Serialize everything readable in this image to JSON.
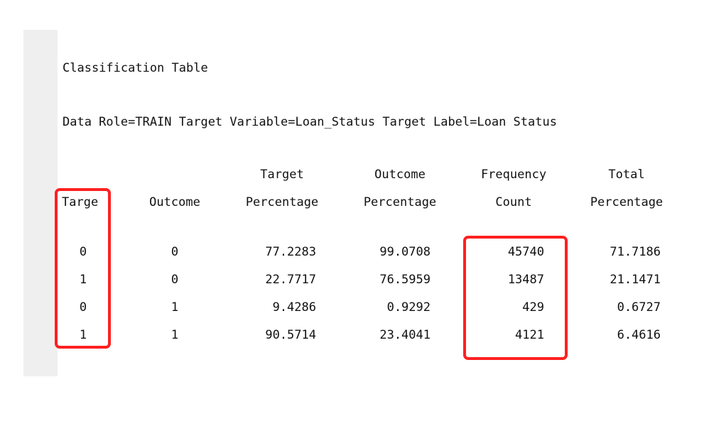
{
  "report": {
    "title": "Classification Table",
    "subtitle": "Data Role=TRAIN Target Variable=Loan_Status Target Label=Loan Status"
  },
  "table": {
    "headers": {
      "target": [
        "",
        "Targe"
      ],
      "outcome": [
        "",
        "Outcome"
      ],
      "target_pct": [
        "Target",
        "Percentage"
      ],
      "outcome_pct": [
        "Outcome",
        "Percentage"
      ],
      "freq": [
        "Frequency",
        "Count"
      ],
      "total_pct": [
        "Total",
        "Percentage"
      ]
    },
    "rows": [
      {
        "target": "0",
        "outcome": "0",
        "target_pct": "77.2283",
        "outcome_pct": "99.0708",
        "freq": "45740",
        "total_pct": "71.7186"
      },
      {
        "target": "1",
        "outcome": "0",
        "target_pct": "22.7717",
        "outcome_pct": "76.5959",
        "freq": "13487",
        "total_pct": "21.1471"
      },
      {
        "target": "0",
        "outcome": "1",
        "target_pct": "9.4286",
        "outcome_pct": "0.9292",
        "freq": "429",
        "total_pct": "0.6727"
      },
      {
        "target": "1",
        "outcome": "1",
        "target_pct": "90.5714",
        "outcome_pct": "23.4041",
        "freq": "4121",
        "total_pct": "6.4616"
      }
    ]
  },
  "annotations": {
    "highlight_color": "#ff2020",
    "highlighted_columns": [
      "Targe",
      "Frequency Count"
    ]
  }
}
